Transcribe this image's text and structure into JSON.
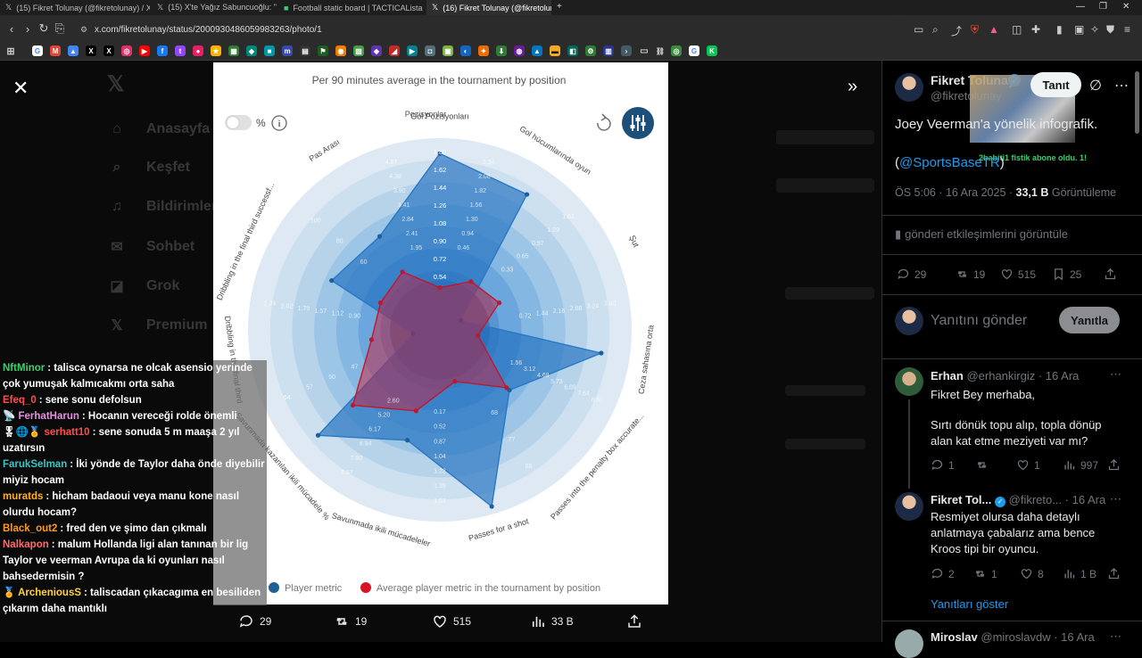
{
  "browser": {
    "tabs": [
      {
        "label": "(15) Fikret Tolunay (@fikretolunay) / X"
      },
      {
        "label": "(15) X'te Yağız Sabuncuoğlu: \"📌 PS"
      },
      {
        "label": "Football static board | TACTICALista"
      },
      {
        "label": "(16) Fikret Tolunay (@fikretolun"
      }
    ],
    "url": "x.com/fikretolunay/status/2000930486059983263/photo/1"
  },
  "viewer": {
    "bg_nav": [
      {
        "icon": "home-icon",
        "label": "Anasayfa"
      },
      {
        "icon": "search-icon",
        "label": "Keşfet"
      },
      {
        "icon": "bell-icon",
        "label": "Bildirimler"
      },
      {
        "icon": "mail-icon",
        "label": "Sohbet"
      },
      {
        "icon": "grok-icon",
        "label": "Grok"
      },
      {
        "icon": "premium-icon",
        "label": "Premium"
      }
    ],
    "actions": {
      "replies": "29",
      "reposts": "19",
      "likes": "515",
      "views": "33 B"
    }
  },
  "chart_data": {
    "type": "radar",
    "title": "Per 90 minutes average in the tournament by position",
    "center_label": "Pozisyonlar",
    "toggle_label": "%",
    "metrics": [
      {
        "label": "Gol Pozisyonları",
        "ticks": [
          "0.46",
          "0.94",
          "1.30",
          "1.56",
          "1.82",
          "2.08",
          "2.34"
        ]
      },
      {
        "label": "Gol hücumlarında oyun",
        "ticks": [
          "0.33",
          "0.65",
          "0.97",
          "1.29",
          "1.61"
        ]
      },
      {
        "label": "Şut",
        "ticks": [
          "0.72",
          "1.44",
          "2.16",
          "2.88",
          "3.24",
          "3.60"
        ]
      },
      {
        "label": "Ceza sahasına orta",
        "ticks": [
          "1.56",
          "3.12",
          "4.68",
          "5.73",
          "6.89",
          "7.64",
          "8.60"
        ]
      },
      {
        "label": "Passes into the penalty box accurate...",
        "ticks": [
          "68",
          "77",
          "85"
        ]
      },
      {
        "label": "Passes for a shot",
        "ticks": [
          "0.17",
          "0.52",
          "0.87",
          "1.04",
          "1.22",
          "1.39",
          "1.57"
        ]
      },
      {
        "label": "Savunmada ikili mücadeleler",
        "ticks": [
          "2.60",
          "5.20",
          "6.17",
          "6.94",
          "7.80",
          "8.67"
        ]
      },
      {
        "label": "Savunmada kazanılan ikili mücadele %",
        "ticks": [
          "47",
          "50",
          "57",
          "64"
        ]
      },
      {
        "label": "Dribbling in the final third",
        "ticks": [
          "0.90",
          "1.12",
          "1.57",
          "1.79",
          "2.02",
          "2.24"
        ]
      },
      {
        "label": "Dribbling in the final third successf...",
        "ticks": [
          "60",
          "80",
          "100"
        ]
      },
      {
        "label": "Pas Arası",
        "ticks": [
          "1.95",
          "2.41",
          "2.84",
          "3.41",
          "3.90",
          "4.38",
          "4.87"
        ]
      }
    ],
    "axis_ticks": [
      "1.80",
      "1.62",
      "1.44",
      "1.26",
      "1.08",
      "0.90",
      "0.72",
      "0.54"
    ],
    "series": [
      {
        "name": "Player metric",
        "color": "#1f6fb8",
        "values": [
          0.92,
          0.84,
          0.12,
          0.85,
          0.48,
          0.96,
          0.6,
          0.84,
          0.14,
          0.62,
          0.58
        ]
      },
      {
        "name": "Average player metric in the tournament by position",
        "color": "#d9122a",
        "values": [
          0.22,
          0.3,
          0.34,
          0.2,
          0.46,
          0.28,
          0.44,
          0.6,
          0.36,
          0.34,
          0.36
        ]
      }
    ],
    "legend_position": "bottom"
  },
  "chat": [
    {
      "nick": "NftMinor",
      "nick_color": "#3ccf6e",
      "msg": ": talisca oynarsa ne olcak asensio yerinde çok yumuşak kalmıcakmı orta saha"
    },
    {
      "nick": "Efeq_0",
      "nick_color": "#ff4d4d",
      "msg": ": sene sonu defolsun"
    },
    {
      "nick": "FerhatHarun",
      "nick_color": "#e58fe0",
      "msg": ": Hocanın vereceği rolde önemli",
      "badge": "📡"
    },
    {
      "nick": "serhatt10",
      "nick_color": "#ff4d4d",
      "msg": ": sene sonuda 5 m maaşa 2 yıl uzatırsın",
      "badge": "🎖🌐🏅"
    },
    {
      "nick": "FarukSelman",
      "nick_color": "#35c6c6",
      "msg": ": İki yönde de Taylor daha önde diyebilir miyiz hocam"
    },
    {
      "nick": "muratds",
      "nick_color": "#ffb020",
      "msg": ": hicham badaoui veya manu kone nasıl olurdu hocam?"
    },
    {
      "nick": "Black_out2",
      "nick_color": "#ff9a1f",
      "msg": ": fred den ve şimo dan çıkmalı"
    },
    {
      "nick": "Nalkapon",
      "nick_color": "#ff6b6b",
      "msg": ": malum Hollanda ligi alan tanınan bir lig Taylor ve veerman Avrupa da ki oyunları nasıl bahsedermisin ?"
    },
    {
      "nick": "ArcheniousS",
      "nick_color": "#ffd23f",
      "msg": ": taliscadan çıkacagıma en besiliden çıkarım daha mantıklı",
      "badge": "🏅"
    }
  ],
  "tweet": {
    "author_name": "Fikret Tolunay",
    "handle": "@fikretolunay",
    "follow_label": "Tanıt",
    "text": "Joey Veerman'a yönelik infografik.",
    "mention_open": "(",
    "mention": "@SportsBaseTR",
    "mention_close": ")",
    "time": "ÖS 5:06 · 16 Ara 2025 ·",
    "views": "33,1 B",
    "views_label": "Görüntüleme",
    "engagement_label": "gönderi etkileşimlerini görüntüle",
    "stats": {
      "replies": "29",
      "reposts": "19",
      "likes": "515",
      "bookmarks": "25"
    },
    "reply_placeholder": "Yanıtını gönder",
    "reply_button": "Yanıtla",
    "overlay_note": "2babiti1 fistik abone oldu. 1!"
  },
  "replies": [
    {
      "name": "Erhan",
      "handle": "@erhankirgiz · 16 Ara",
      "lines": [
        "Fikret Bey merhaba,",
        "",
        "Sırtı dönük topu alıp, topla dönüp alan kat etme meziyeti var mı?"
      ],
      "stats": {
        "replies": "1",
        "reposts": "",
        "likes": "1",
        "views": "997"
      }
    },
    {
      "name": "Fikret Tol...",
      "handle": "@fikreto... · 16 Ara",
      "lines": [
        "Resmiyet olursa daha detaylı anlatmaya çabalarız ama bence Kroos tipi bir oyuncu."
      ],
      "stats": {
        "replies": "2",
        "reposts": "1",
        "likes": "8",
        "views": "1 B"
      }
    },
    {
      "name": "Miroslav",
      "handle": "@miroslavdw · 16 Ara",
      "lines": [],
      "stats": {}
    }
  ],
  "show_replies_label": "Yanıtları göster"
}
